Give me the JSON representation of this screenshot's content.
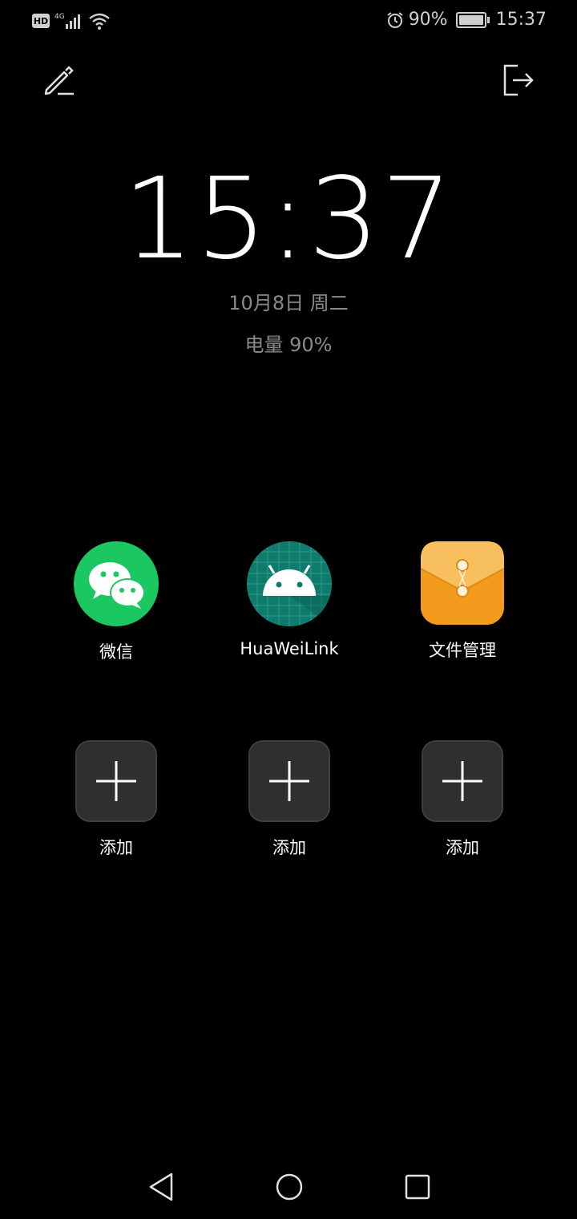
{
  "status_bar": {
    "hd_badge": "HD",
    "network": "4G",
    "battery_percent": "90%",
    "time": "15:37",
    "icons": [
      "signal-icon",
      "wifi-icon",
      "alarm-icon",
      "battery-icon"
    ]
  },
  "toolbar": {
    "edit_icon": "edit-pencil-icon",
    "exit_icon": "exit-icon"
  },
  "clock": {
    "time": "15:37",
    "date": "10月8日 周二",
    "battery": "电量 90%"
  },
  "apps": [
    {
      "label": "微信",
      "icon": "wechat-icon",
      "color": "#1bc760"
    },
    {
      "label": "HuaWeiLink",
      "icon": "android-icon",
      "color": "#0f7b6c"
    },
    {
      "label": "文件管理",
      "icon": "file-manager-icon",
      "color": "#f4a21f"
    }
  ],
  "add_slots": [
    {
      "label": "添加",
      "icon": "plus-icon"
    },
    {
      "label": "添加",
      "icon": "plus-icon"
    },
    {
      "label": "添加",
      "icon": "plus-icon"
    }
  ],
  "nav_bar": {
    "buttons": [
      "back-icon",
      "home-icon",
      "recents-icon"
    ]
  }
}
